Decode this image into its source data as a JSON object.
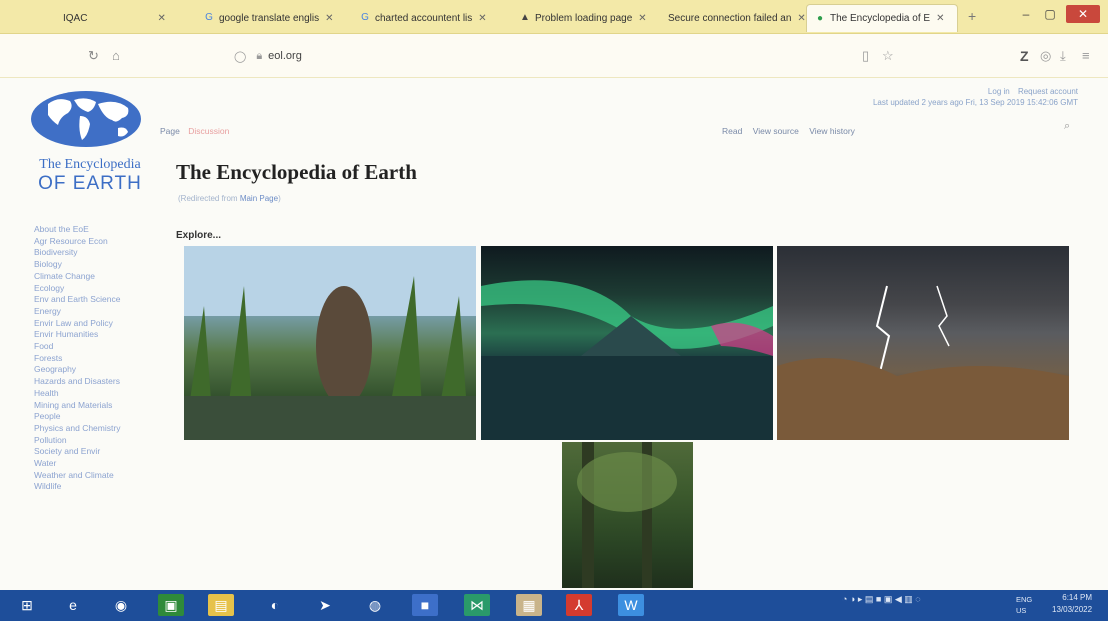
{
  "browser": {
    "tabs": [
      {
        "label": "IQAC",
        "icon": "folder-icon"
      },
      {
        "label": "google translate englis",
        "icon": "google-icon"
      },
      {
        "label": "charted accountent lis",
        "icon": "google-icon"
      },
      {
        "label": "Problem loading page",
        "icon": "warning-icon"
      },
      {
        "label": "Secure connection failed an",
        "icon": "none"
      },
      {
        "label": "The Encyclopedia of E",
        "icon": "site-icon"
      }
    ],
    "active_tab_index": 5,
    "url": "eol.org"
  },
  "header": {
    "user_links": [
      "Log in",
      "Request account"
    ],
    "last_updated": "Last updated 2 years ago Fri, 13 Sep 2019 15:42:06 GMT",
    "left_tabs": [
      "Page",
      "Discussion"
    ],
    "right_tabs": [
      "Read",
      "View source",
      "View history"
    ]
  },
  "logo": {
    "line1": "The Encyclopedia",
    "line2": "OF EARTH"
  },
  "main": {
    "title": "The Encyclopedia of Earth",
    "redirect_prefix": "(Redirected from",
    "redirect_link": "Main Page",
    "redirect_suffix": ")",
    "section_heading": "Explore..."
  },
  "sidebar": {
    "items": [
      "About the EoE",
      "Agr Resource Econ",
      "Biodiversity",
      "Biology",
      "Climate Change",
      "Ecology",
      "Env and Earth Science",
      "Energy",
      "Envir Law and Policy",
      "Envir Humanities",
      "Food",
      "Forests",
      "Geography",
      "Hazards and Disasters",
      "Health",
      "Mining and Materials",
      "People",
      "Physics and Chemistry",
      "Pollution",
      "Society and Envir",
      "Water",
      "Weather and Climate",
      "Wildlife"
    ]
  },
  "taskbar": {
    "tray_lang": "ENG",
    "tray_region": "US",
    "time": "6:14 PM",
    "date": "13/03/2022"
  }
}
